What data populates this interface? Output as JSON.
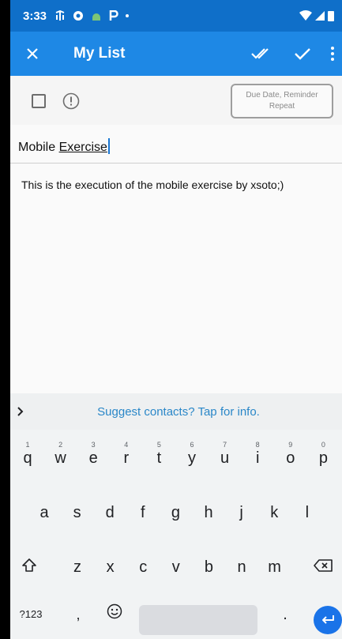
{
  "status_bar": {
    "time": "3:33"
  },
  "app_bar": {
    "title": "My List"
  },
  "task": {
    "due_button_line1": "Due Date, Reminder",
    "due_button_line2": "Repeat",
    "subject_prefix": "Mobile ",
    "subject_underlined": "Exercise",
    "notes": "This is the execution of the mobile exercise by xsoto;)"
  },
  "suggestion_bar": {
    "text": "Suggest contacts? Tap for info."
  },
  "keyboard": {
    "row1": [
      {
        "k": "q",
        "h": "1"
      },
      {
        "k": "w",
        "h": "2"
      },
      {
        "k": "e",
        "h": "3"
      },
      {
        "k": "r",
        "h": "4"
      },
      {
        "k": "t",
        "h": "5"
      },
      {
        "k": "y",
        "h": "6"
      },
      {
        "k": "u",
        "h": "7"
      },
      {
        "k": "i",
        "h": "8"
      },
      {
        "k": "o",
        "h": "9"
      },
      {
        "k": "p",
        "h": "0"
      }
    ],
    "row2": [
      "a",
      "s",
      "d",
      "f",
      "g",
      "h",
      "j",
      "k",
      "l"
    ],
    "row3": [
      "z",
      "x",
      "c",
      "v",
      "b",
      "n",
      "m"
    ],
    "symbols_label": "?123",
    "comma": ",",
    "period": "."
  },
  "colors": {
    "status_bar": "#0f6fc9",
    "app_bar": "#1e88e5",
    "link": "#2a87c8",
    "enter_key": "#1a73e8"
  }
}
